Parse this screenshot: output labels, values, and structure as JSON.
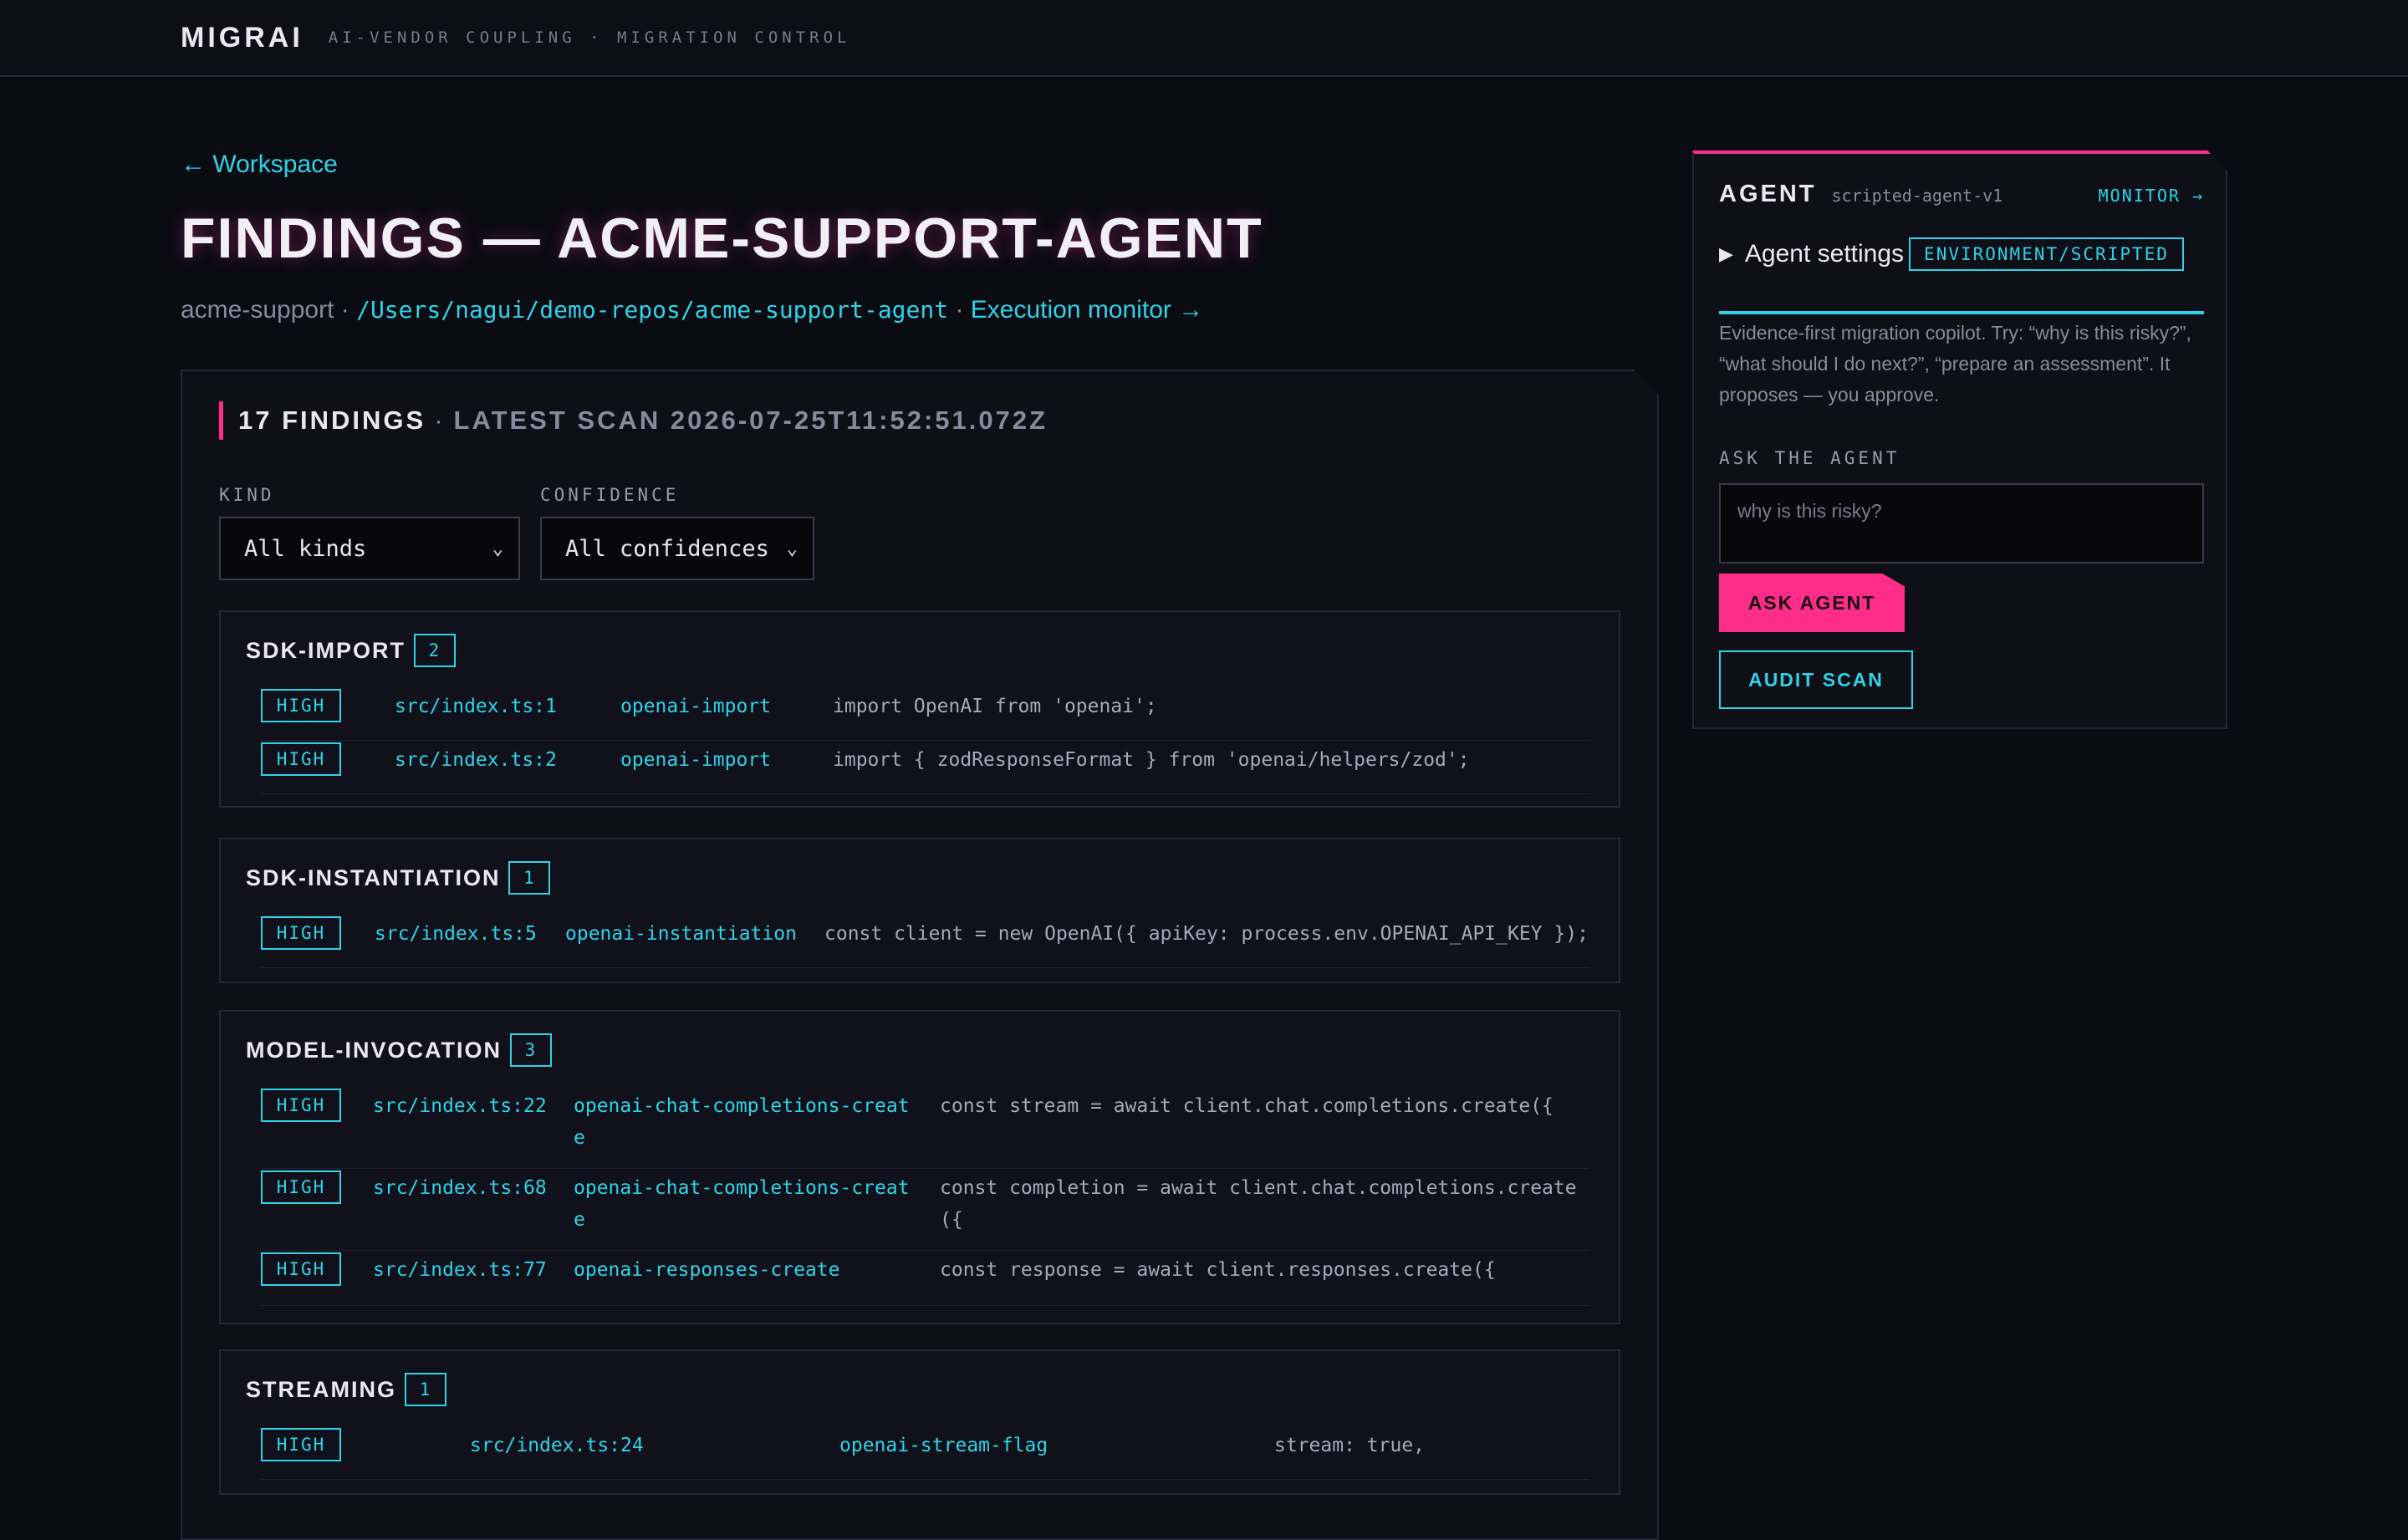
{
  "header": {
    "brand": "MIGRAI",
    "tagline": "AI-VENDOR COUPLING · MIGRATION CONTROL"
  },
  "nav": {
    "back": "← Workspace"
  },
  "page": {
    "title": "FINDINGS — ACME-SUPPORT-AGENT",
    "org": "acme-support",
    "sep1": " · ",
    "path": "/Users/nagui/demo-repos/acme-support-agent",
    "sep2": " · ",
    "monitor_link": "Execution monitor →"
  },
  "findings": {
    "count_label": "17 FINDINGS",
    "separator": "·",
    "latest_scan": "LATEST SCAN 2026-07-25T11:52:51.072Z",
    "filters": {
      "kind_label": "KIND",
      "kind_value": "All kinds",
      "confidence_label": "CONFIDENCE",
      "confidence_value": "All confidences"
    },
    "groups": [
      {
        "name": "SDK-IMPORT",
        "count": "2",
        "rows": [
          {
            "severity": "HIGH",
            "file": "src/index.ts:1",
            "rule": "openai-import",
            "code": "import OpenAI from 'openai';"
          },
          {
            "severity": "HIGH",
            "file": "src/index.ts:2",
            "rule": "openai-import",
            "code": "import { zodResponseFormat } from 'openai/helpers/zod';"
          }
        ]
      },
      {
        "name": "SDK-INSTANTIATION",
        "count": "1",
        "rows": [
          {
            "severity": "HIGH",
            "file": "src/index.ts:5",
            "rule": "openai-instantiation",
            "code": "const client = new OpenAI({ apiKey: process.env.OPENAI_API_KEY });"
          }
        ]
      },
      {
        "name": "MODEL-INVOCATION",
        "count": "3",
        "rows": [
          {
            "severity": "HIGH",
            "file": "src/index.ts:22",
            "rule": "openai-chat-completions-creat",
            "rule_wrap": "e",
            "code": "const stream = await client.chat.completions.create({"
          },
          {
            "severity": "HIGH",
            "file": "src/index.ts:68",
            "rule": "openai-chat-completions-creat",
            "rule_wrap": "e",
            "code": "const completion = await client.chat.completions.create",
            "code_wrap": "({"
          },
          {
            "severity": "HIGH",
            "file": "src/index.ts:77",
            "rule": "openai-responses-create",
            "code": "const response = await client.responses.create({"
          }
        ]
      },
      {
        "name": "STREAMING",
        "count": "1",
        "rows": [
          {
            "severity": "HIGH",
            "file": "src/index.ts:24",
            "rule": "openai-stream-flag",
            "code": "stream: true,"
          }
        ]
      }
    ]
  },
  "agent": {
    "label": "AGENT",
    "version": "scripted-agent-v1",
    "monitor": "MONITOR →",
    "settings_label": "Agent settings",
    "environment": "ENVIRONMENT/SCRIPTED",
    "description": "Evidence-first migration copilot. Try: “why is this risky?”, “what should I do next?”, “prepare an assessment”. It proposes — you approve.",
    "ask_label": "ASK THE AGENT",
    "ask_placeholder": "why is this risky?",
    "ask_button": "ASK AGENT",
    "audit_button": "AUDIT SCAN"
  },
  "colors": {
    "accent_cyan": "#2fd3e6",
    "accent_pink": "#ff2d8a",
    "background": "#0b0b13"
  }
}
